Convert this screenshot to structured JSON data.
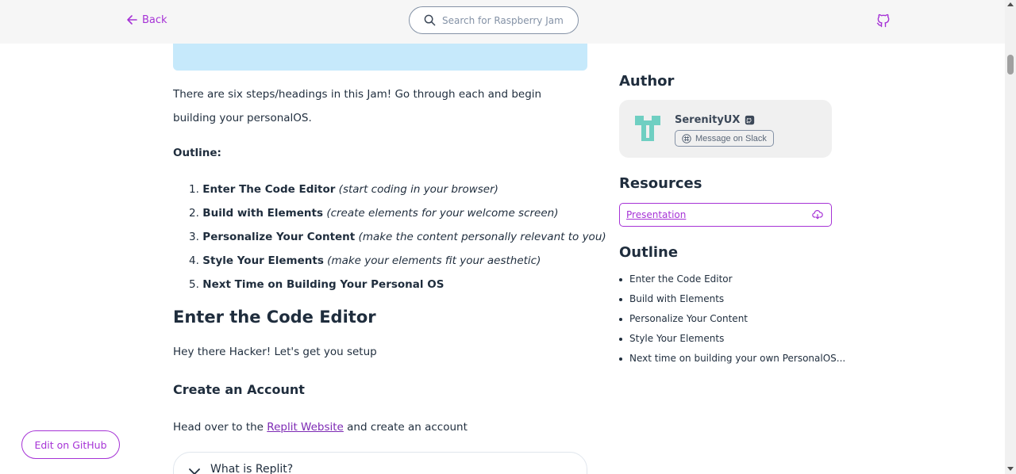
{
  "header": {
    "back_label": "Back",
    "search_placeholder": "Search for Raspberry Jam"
  },
  "main": {
    "intro": "There are six steps/headings in this Jam! Go through each and begin building your personalOS.",
    "outline_label": "Outline:",
    "steps": [
      {
        "num": "1.",
        "name": "Enter The Code Editor",
        "note": "(start coding in your browser)"
      },
      {
        "num": "2.",
        "name": "Build with Elements",
        "note": "(create elements for your welcome screen)"
      },
      {
        "num": "3.",
        "name": "Personalize Your Content",
        "note": "(make the content personally relevant to you)"
      },
      {
        "num": "4.",
        "name": "Style Your Elements",
        "note": "(make your elements fit your aesthetic)"
      },
      {
        "num": "5.",
        "name": "Next Time on Building Your Personal OS",
        "note": ""
      }
    ],
    "section_title": "Enter the Code Editor",
    "section_intro": "Hey there Hacker! Let's get you setup",
    "subsection_title": "Create an Account",
    "head_over_prefix": "Head over to the",
    "head_over_link": "Replit Website",
    "head_over_suffix": "and create an account",
    "accordion_title": "What is Replit?"
  },
  "sidebar": {
    "author_heading": "Author",
    "author_name": "SerenityUX",
    "slack_label": "Message on Slack",
    "resources_heading": "Resources",
    "resource_label": "Presentation",
    "outline_heading": "Outline",
    "outline_items": [
      "Enter the Code Editor",
      "Build with Elements",
      "Personalize Your Content",
      "Style Your Elements",
      "Next time on building your own PersonalOS..."
    ]
  },
  "edit_on_github_label": "Edit on GitHub",
  "colors": {
    "accent": "#a633d6",
    "callout": "#c6e9fb",
    "avatar": "#6fcfc2"
  },
  "icons": [
    "arrow-left-icon",
    "search-icon",
    "github-icon",
    "slack-icon",
    "cloud-download-icon",
    "chevron-down-icon"
  ]
}
